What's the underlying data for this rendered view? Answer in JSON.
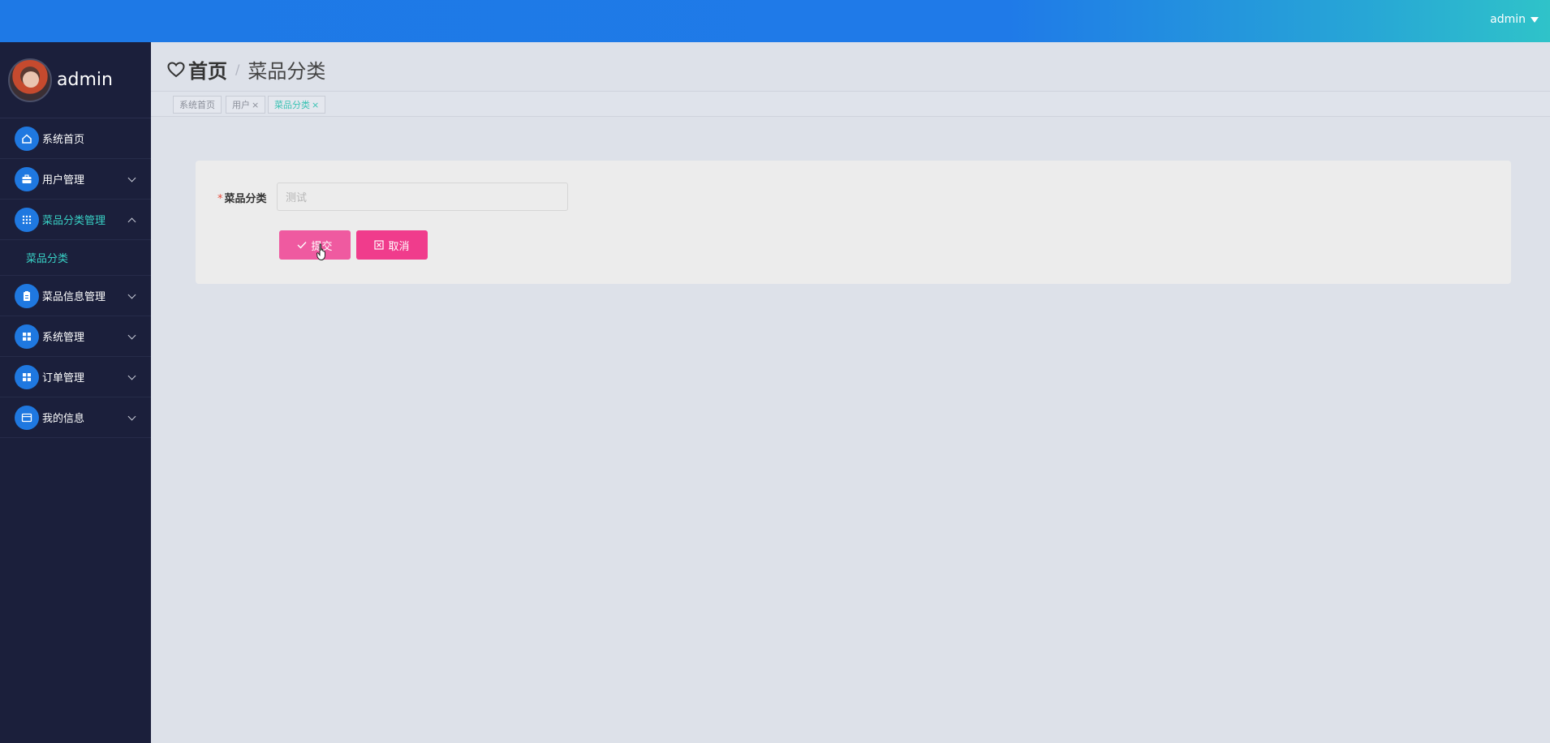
{
  "topbar": {
    "user": "admin"
  },
  "sidebar": {
    "profile_name": "admin",
    "items": [
      {
        "label": "系统首页",
        "icon": "home-icon"
      },
      {
        "label": "用户管理",
        "icon": "briefcase-icon"
      },
      {
        "label": "菜品分类管理",
        "icon": "grid-icon"
      },
      {
        "label": "菜品信息管理",
        "icon": "clipboard-icon"
      },
      {
        "label": "系统管理",
        "icon": "apps-icon"
      },
      {
        "label": "订单管理",
        "icon": "apps-icon"
      },
      {
        "label": "我的信息",
        "icon": "card-icon"
      }
    ],
    "submenu": {
      "label": "菜品分类"
    }
  },
  "header": {
    "home": "首页",
    "current": "菜品分类"
  },
  "tabs": [
    {
      "label": "系统首页"
    },
    {
      "label": "用户"
    },
    {
      "label": "菜品分类"
    }
  ],
  "form": {
    "required_mark": "*",
    "field_label": "菜品分类",
    "field_value": "测试",
    "submit_label": "提交",
    "cancel_label": "取消"
  },
  "colors": {
    "accent": "#1f78e0",
    "active_text": "#38d1c5",
    "submit": "#ef5aa0",
    "cancel": "#f03c8c"
  }
}
